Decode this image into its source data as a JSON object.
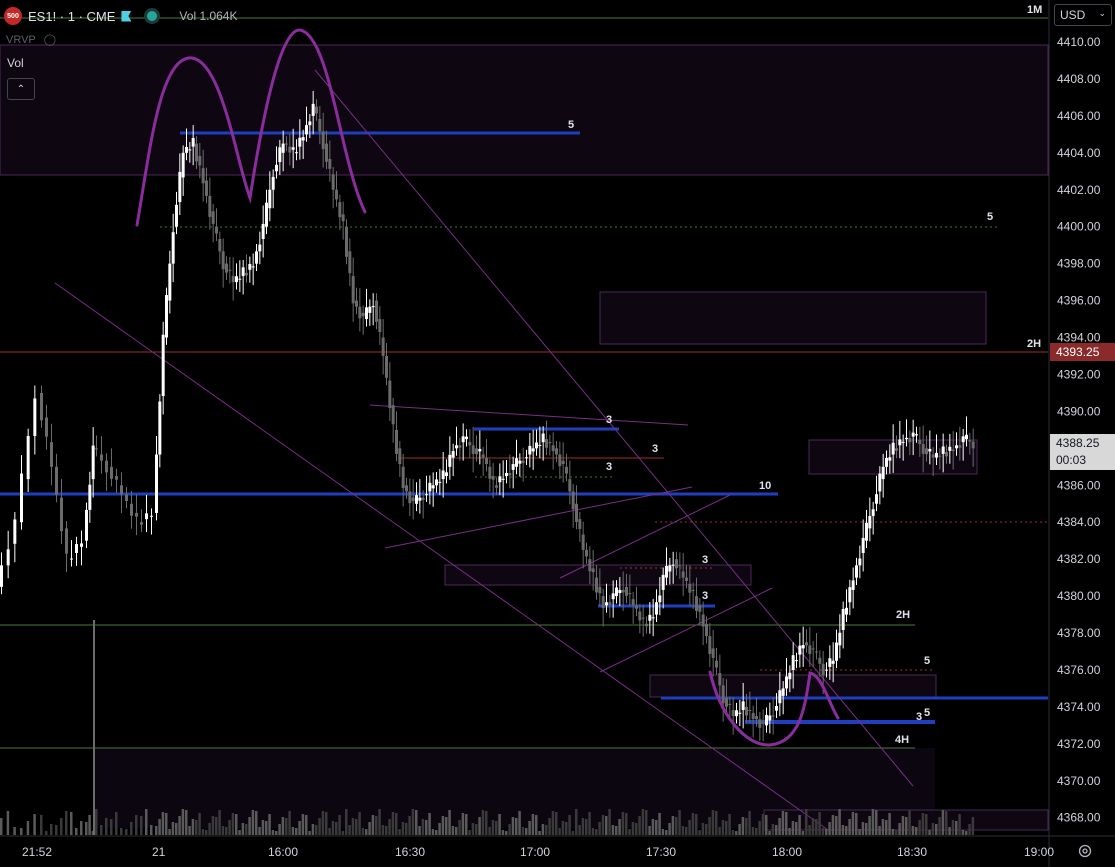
{
  "header": {
    "badge": "500",
    "symbol": "ES1! · 1 · CME",
    "volume": "Vol 1.064K",
    "indicator": "VRVP",
    "sub_pane": "Vol",
    "currency": "USD",
    "timeframe_badge": "1M"
  },
  "colors": {
    "background": "#000000",
    "up_candle": "#ffffff",
    "down_candle": "#6b6b6b",
    "blue_level": "#1f3fbf",
    "purple": "#7b2d8b",
    "green_level": "#4a7a3a",
    "red_level": "#9b3030",
    "current_price_bg": "#d8d8d8",
    "last_price_tag": "#8b2a2a"
  },
  "price_axis": {
    "labels": [
      "4410.00",
      "4408.00",
      "4406.00",
      "4404.00",
      "4402.00",
      "4400.00",
      "4398.00",
      "4396.00",
      "4394.00",
      "4392.00",
      "4390.00",
      "4386.00",
      "4384.00",
      "4382.00",
      "4380.00",
      "4378.00",
      "4376.00",
      "4374.00",
      "4372.00",
      "4370.00",
      "4368.00"
    ],
    "range": [
      4367.5,
      4411.0
    ],
    "level_tag": {
      "price": "4393.25",
      "label": "2H"
    },
    "current_price": {
      "price": "4388.25",
      "countdown": "00:03"
    }
  },
  "time_axis": {
    "labels": [
      "21:52",
      "21",
      "16:00",
      "16:30",
      "17:00",
      "17:30",
      "18:00",
      "18:30",
      "19:00"
    ]
  },
  "drawings": {
    "level_labels": {
      "top_5": "5",
      "upper_right_5": "5",
      "mid_3a": "3",
      "mid_3b": "3",
      "mid_3c": "3",
      "ten": "10",
      "right_3a": "3",
      "right_3b": "3",
      "green_2h": "2H",
      "red_5": "5",
      "bottom_5": "5",
      "bottom_3": "3",
      "four_h": "4H"
    }
  }
}
